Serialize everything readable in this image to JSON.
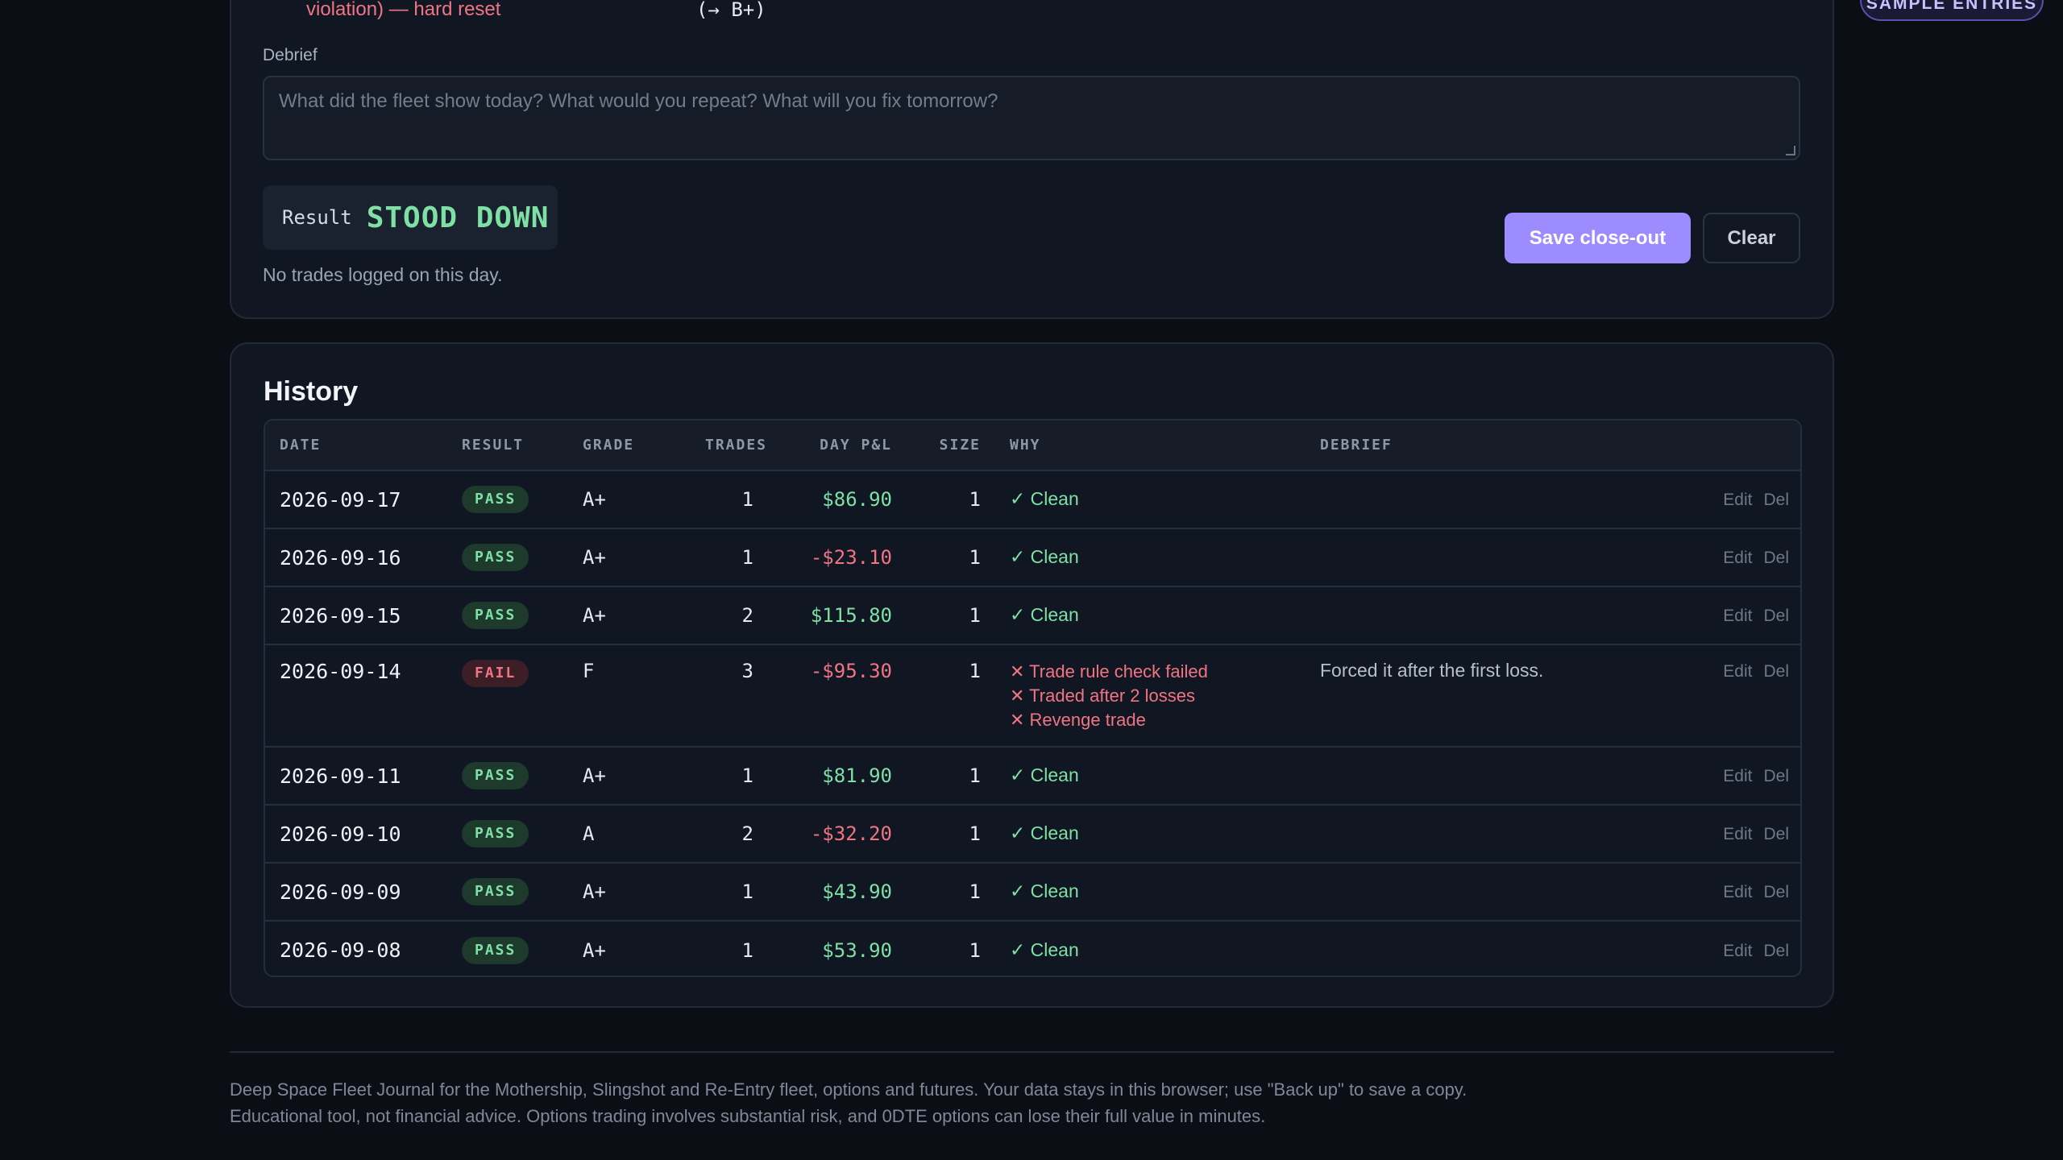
{
  "closeout": {
    "violation_text": "violation) — hard reset",
    "arrow_text": "(→ B+)",
    "debrief_label": "Debrief",
    "debrief_placeholder": "What did the fleet show today? What would you repeat? What will you fix tomorrow?",
    "result_label": "Result",
    "result_value": "STOOD DOWN",
    "no_trades_note": "No trades logged on this day.",
    "save_label": "Save close-out",
    "clear_label": "Clear"
  },
  "sample_badge": "SAMPLE ENTRIES",
  "history": {
    "title": "History",
    "columns": [
      "DATE",
      "RESULT",
      "GRADE",
      "TRADES",
      "DAY P&L",
      "SIZE",
      "WHY",
      "DEBRIEF"
    ],
    "edit_label": "Edit",
    "del_label": "Del",
    "rows": [
      {
        "date": "2026-09-17",
        "result": "PASS",
        "grade": "A+",
        "trades": "1",
        "pnl": "$86.90",
        "size": "1",
        "why": [
          "✓ Clean"
        ],
        "debrief": ""
      },
      {
        "date": "2026-09-16",
        "result": "PASS",
        "grade": "A+",
        "trades": "1",
        "pnl": "-$23.10",
        "size": "1",
        "why": [
          "✓ Clean"
        ],
        "debrief": ""
      },
      {
        "date": "2026-09-15",
        "result": "PASS",
        "grade": "A+",
        "trades": "2",
        "pnl": "$115.80",
        "size": "1",
        "why": [
          "✓ Clean"
        ],
        "debrief": ""
      },
      {
        "date": "2026-09-14",
        "result": "FAIL",
        "grade": "F",
        "trades": "3",
        "pnl": "-$95.30",
        "size": "1",
        "why": [
          "✕ Trade rule check failed",
          "✕ Traded after 2 losses",
          "✕ Revenge trade"
        ],
        "debrief": "Forced it after the first loss."
      },
      {
        "date": "2026-09-11",
        "result": "PASS",
        "grade": "A+",
        "trades": "1",
        "pnl": "$81.90",
        "size": "1",
        "why": [
          "✓ Clean"
        ],
        "debrief": ""
      },
      {
        "date": "2026-09-10",
        "result": "PASS",
        "grade": "A",
        "trades": "2",
        "pnl": "-$32.20",
        "size": "1",
        "why": [
          "✓ Clean"
        ],
        "debrief": ""
      },
      {
        "date": "2026-09-09",
        "result": "PASS",
        "grade": "A+",
        "trades": "1",
        "pnl": "$43.90",
        "size": "1",
        "why": [
          "✓ Clean"
        ],
        "debrief": ""
      },
      {
        "date": "2026-09-08",
        "result": "PASS",
        "grade": "A+",
        "trades": "1",
        "pnl": "$53.90",
        "size": "1",
        "why": [
          "✓ Clean"
        ],
        "debrief": ""
      }
    ]
  },
  "footer": {
    "line1": "Deep Space Fleet Journal for the Mothership, Slingshot and Re-Entry fleet, options and futures. Your data stays in this browser; use \"Back up\" to save a copy.",
    "line2": "Educational tool, not financial advice. Options trading involves substantial risk, and 0DTE options can lose their full value in minutes."
  },
  "colors": {
    "accent": "#9d8cff",
    "positive": "#7ee0a4",
    "negative": "#f07483",
    "background": "#0b0e15"
  }
}
